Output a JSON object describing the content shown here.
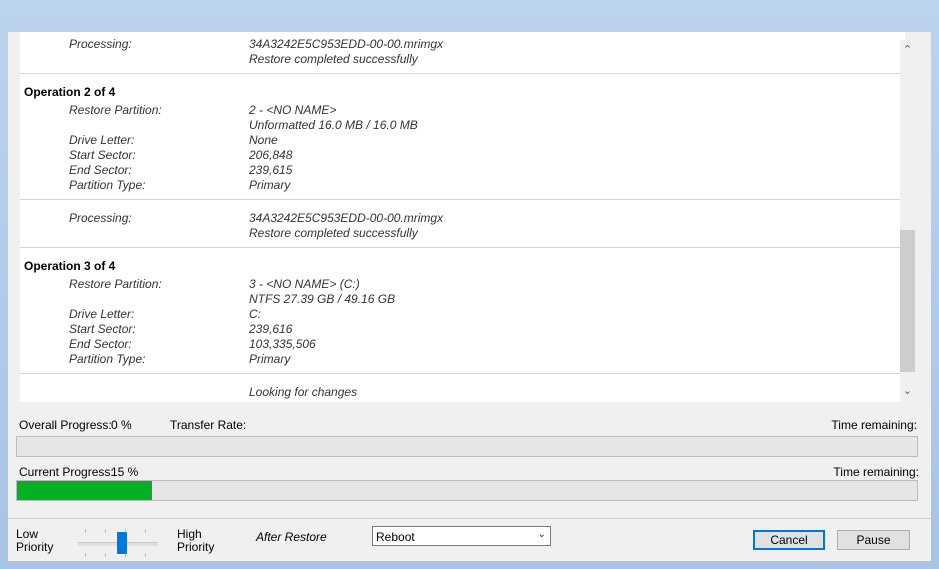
{
  "log": {
    "op1_tail": {
      "processing_label": "Processing:",
      "processing_file": "34A3242E5C953EDD-00-00.mrimgx",
      "processing_status": "Restore completed successfully"
    },
    "op2": {
      "heading": "Operation 2 of 4",
      "rows": [
        {
          "k": "Restore Partition:",
          "v": "2 - <NO NAME>"
        },
        {
          "k": "",
          "v": "Unformatted 16.0 MB / 16.0 MB"
        },
        {
          "k": "Drive Letter:",
          "v": "None"
        },
        {
          "k": "Start Sector:",
          "v": "206,848"
        },
        {
          "k": "End Sector:",
          "v": "239,615"
        },
        {
          "k": "Partition Type:",
          "v": "Primary"
        }
      ],
      "processing_label": "Processing:",
      "processing_file": "34A3242E5C953EDD-00-00.mrimgx",
      "processing_status": "Restore completed successfully"
    },
    "op3": {
      "heading": "Operation 3 of 4",
      "rows": [
        {
          "k": "Restore Partition:",
          "v": "3 - <NO NAME> (C:)"
        },
        {
          "k": "",
          "v": "NTFS 27.39 GB / 49.16 GB"
        },
        {
          "k": "Drive Letter:",
          "v": "C:"
        },
        {
          "k": "Start Sector:",
          "v": "239,616"
        },
        {
          "k": "End Sector:",
          "v": "103,335,506"
        },
        {
          "k": "Partition Type:",
          "v": "Primary"
        }
      ],
      "status": "Looking for changes"
    }
  },
  "progress": {
    "overall_label": "Overall Progress:",
    "overall_value": "0 %",
    "overall_fraction": 0,
    "transfer_rate_label": "Transfer Rate:",
    "time_remaining_label": "Time remaining:",
    "current_label": "Current Progress:",
    "current_value": "15 %",
    "current_fraction": 0.15,
    "current_time_remaining_label": "Time remaining:",
    "fill_color": "#06b025"
  },
  "footer": {
    "low_priority": [
      "Low",
      "Priority"
    ],
    "high_priority": [
      "High",
      "Priority"
    ],
    "priority_level": 0.6,
    "after_restore_label": "After Restore",
    "after_restore_value": "Reboot",
    "cancel_label": "Cancel",
    "pause_label": "Pause",
    "accent": "#0078d7"
  }
}
